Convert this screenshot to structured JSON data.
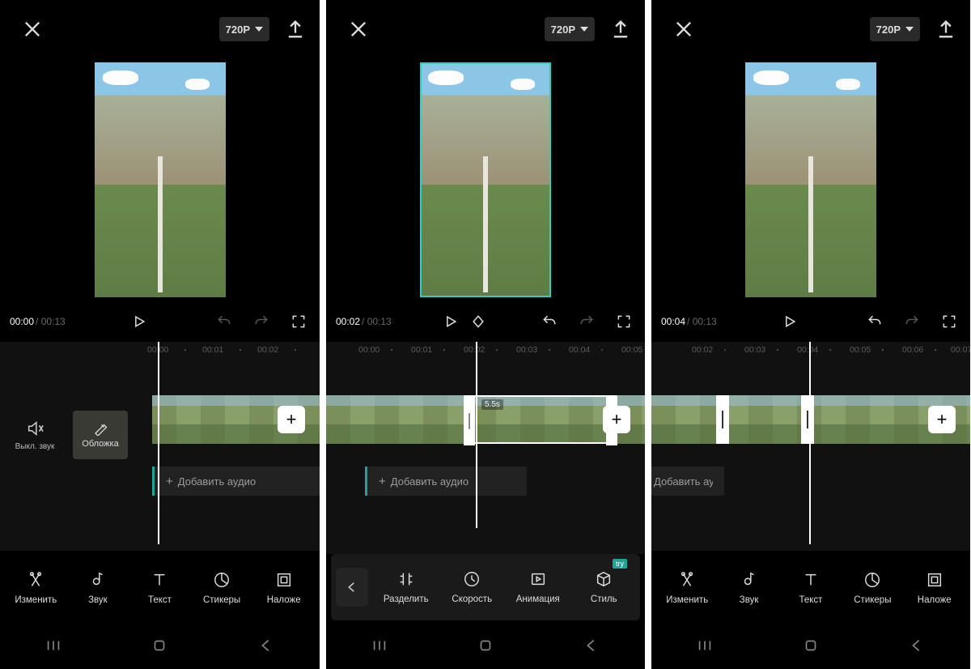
{
  "resolution_label": "720P",
  "total_time": "00:13",
  "add_audio": "Добавить аудио",
  "mute_label": "Выкл. звук",
  "cover_label": "Обложка",
  "clip_duration_label": "5.5s",
  "try_badge": "try",
  "screens": [
    {
      "current_time": "00:00",
      "ruler": [
        "00:00",
        "00:01",
        "00:02"
      ],
      "tools": [
        "Изменить",
        "Звук",
        "Текст",
        "Стикеры",
        "Наложе"
      ]
    },
    {
      "current_time": "00:02",
      "ruler": [
        "00:00",
        "00:01",
        "00:02",
        "00:03",
        "00:04",
        "00:05"
      ],
      "tools": [
        "Разделить",
        "Скорость",
        "Анимация",
        "Стиль"
      ]
    },
    {
      "current_time": "00:04",
      "ruler": [
        "00:02",
        "00:03",
        "00:04",
        "00:05",
        "00:06",
        "00:07"
      ],
      "tools": [
        "Изменить",
        "Звук",
        "Текст",
        "Стикеры",
        "Наложе"
      ]
    }
  ]
}
